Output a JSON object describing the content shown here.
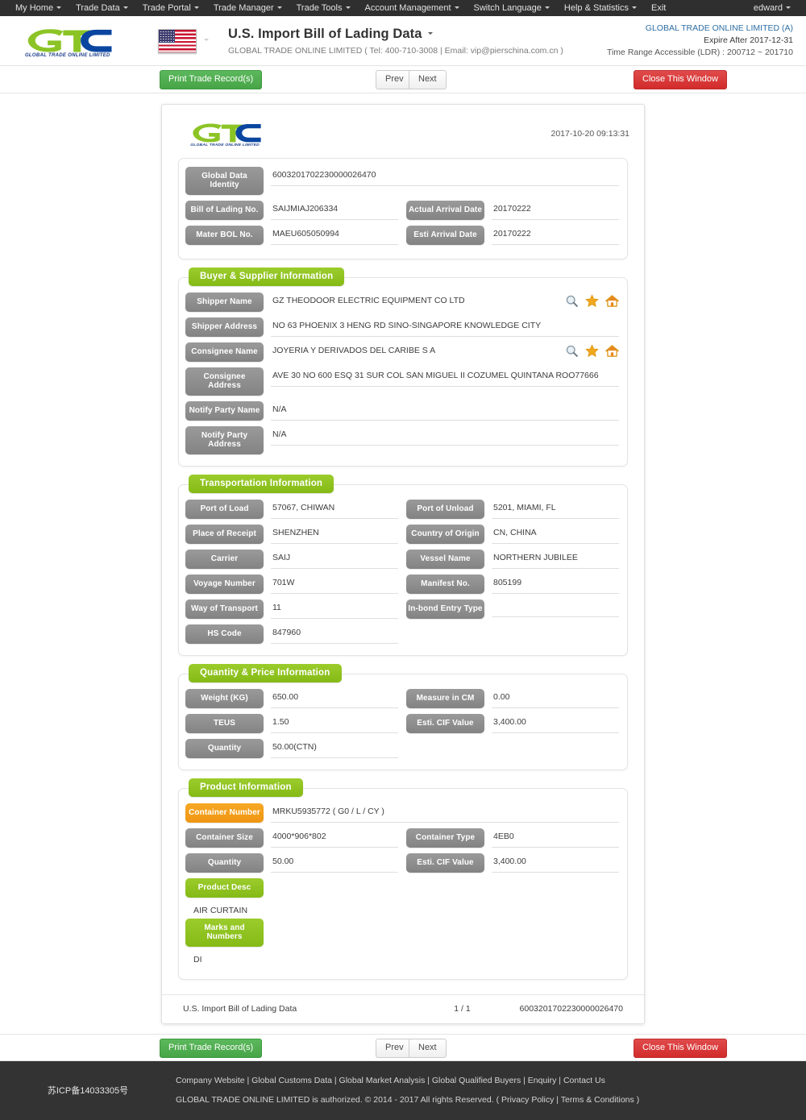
{
  "topnav": {
    "items": [
      {
        "label": "My Home",
        "caret": true
      },
      {
        "label": "Trade Data",
        "caret": true
      },
      {
        "label": "Trade Portal",
        "caret": true
      },
      {
        "label": "Trade Manager",
        "caret": true
      },
      {
        "label": "Trade Tools",
        "caret": true
      },
      {
        "label": "Account Management",
        "caret": true
      },
      {
        "label": "Switch Language",
        "caret": true
      },
      {
        "label": "Help & Statistics",
        "caret": true
      },
      {
        "label": "Exit",
        "caret": false
      }
    ],
    "user": "edward"
  },
  "header": {
    "logo_text": "GLOBAL TRADE ONLINE LIMITED",
    "flag": "us-flag-icon",
    "title": "U.S. Import Bill of Lading Data",
    "subtitle": "GLOBAL TRADE ONLINE LIMITED ( Tel: 400-710-3008 | Email: vip@pierschina.com.cn )",
    "account_name": "GLOBAL TRADE ONLINE LIMITED (A)",
    "expire": "Expire After 2017-12-31",
    "time_range": "Time Range Accessible (LDR) : 200712 ~ 201710"
  },
  "toolbar": {
    "print_label": "Print Trade Record(s)",
    "prev_label": "Prev",
    "next_label": "Next",
    "close_label": "Close This Window"
  },
  "sheet": {
    "timestamp": "2017-10-20 09:13:31",
    "identity": {
      "fields": [
        {
          "label": "Global Data Identity",
          "value": "6003201702230000026470"
        },
        {
          "label": "Bill of Lading No.",
          "value": "SAIJMIAJ206334"
        },
        {
          "label": "Actual Arrival Date",
          "value": "20170222"
        },
        {
          "label": "Mater BOL No.",
          "value": "MAEU605050994"
        },
        {
          "label": "Esti Arrival Date",
          "value": "20170222"
        }
      ]
    },
    "buyer_supplier": {
      "title": "Buyer & Supplier Information",
      "fields": [
        {
          "label": "Shipper Name",
          "value": "GZ THEODOOR ELECTRIC EQUIPMENT CO LTD"
        },
        {
          "label": "Shipper Address",
          "value": "NO 63 PHOENIX 3 HENG RD SINO-SINGAPORE KNOWLEDGE CITY"
        },
        {
          "label": "Consignee Name",
          "value": "JOYERIA Y DERIVADOS DEL CARIBE S A"
        },
        {
          "label": "Consignee Address",
          "value": "AVE 30 NO 600 ESQ 31 SUR COL SAN MIGUEL II COZUMEL QUINTANA ROO77666"
        },
        {
          "label": "Notify Party Name",
          "value": "N/A"
        },
        {
          "label": "Notify Party Address",
          "value": "N/A"
        }
      ],
      "icons": [
        "search-icon",
        "star-icon",
        "home-icon"
      ]
    },
    "transportation": {
      "title": "Transportation Information",
      "fields": [
        {
          "label": "Port of Load",
          "value": "57067, CHIWAN"
        },
        {
          "label": "Port of Unload",
          "value": "5201, MIAMI, FL"
        },
        {
          "label": "Place of Receipt",
          "value": "SHENZHEN"
        },
        {
          "label": "Country of Origin",
          "value": "CN, CHINA"
        },
        {
          "label": "Carrier",
          "value": "SAIJ"
        },
        {
          "label": "Vessel Name",
          "value": "NORTHERN JUBILEE"
        },
        {
          "label": "Voyage Number",
          "value": "701W"
        },
        {
          "label": "Manifest No.",
          "value": "805199"
        },
        {
          "label": "Way of Transport",
          "value": "11"
        },
        {
          "label": "In-bond Entry Type",
          "value": ""
        },
        {
          "label": "HS Code",
          "value": "847960"
        }
      ]
    },
    "quantity_price": {
      "title": "Quantity & Price Information",
      "fields": [
        {
          "label": "Weight (KG)",
          "value": "650.00"
        },
        {
          "label": "Measure in CM",
          "value": "0.00"
        },
        {
          "label": "TEUS",
          "value": "1.50"
        },
        {
          "label": "Esti. CIF Value",
          "value": "3,400.00"
        },
        {
          "label": "Quantity",
          "value": "50.00(CTN)"
        }
      ]
    },
    "product": {
      "title": "Product Information",
      "container_number_label": "Container Number",
      "container_number_value": "MRKU5935772 ( G0 / L / CY )",
      "fields": [
        {
          "label": "Container Size",
          "value": "4000*906*802"
        },
        {
          "label": "Container Type",
          "value": "4EB0"
        },
        {
          "label": "Quantity",
          "value": "50.00"
        },
        {
          "label": "Esti. CIF Value",
          "value": "3,400.00"
        }
      ],
      "product_desc_label": "Product Desc",
      "product_desc_value": "AIR CURTAIN",
      "marks_label": "Marks and Numbers",
      "marks_value": "DI"
    },
    "footer": {
      "left": "U.S. Import Bill of Lading Data",
      "page": "1 / 1",
      "right": "6003201702230000026470"
    }
  },
  "pagefooter": {
    "icp": "苏ICP备14033305号",
    "links": [
      "Company Website",
      "Global Customs Data",
      "Global Market Analysis",
      "Global Qualified Buyers",
      "Enquiry",
      "Contact Us"
    ],
    "copyright_pre": "GLOBAL TRADE ONLINE LIMITED is authorized. © 2014 - 2017 All rights Reserved.  (",
    "privacy": "Privacy Policy",
    "terms": "Terms & Conditions",
    "copyright_post": ")"
  },
  "colors": {
    "accent_green": "#8fc320",
    "accent_orange": "#f0a022",
    "label_gray": "#8e8e8e",
    "nav_dark": "#2f2f2f",
    "danger_red": "#d9534f",
    "link_blue": "#2e6da4"
  }
}
